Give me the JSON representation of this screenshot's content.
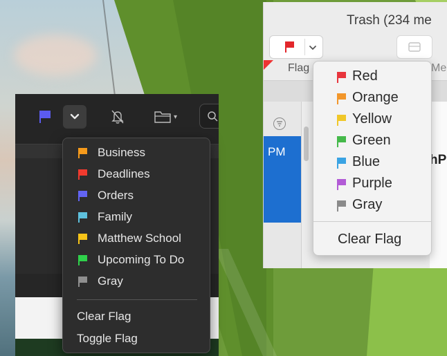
{
  "dark_app": {
    "toolbar": {
      "flag_color": "#5b5bf0",
      "flag_icon": "flag-icon",
      "dropdown_icon": "chevron-down-icon",
      "bell_icon": "bell-slash-icon",
      "folder_icon": "folder-icon",
      "search_icon": "search-icon"
    },
    "menu": {
      "items": [
        {
          "label": "Business",
          "color": "#f59a1b"
        },
        {
          "label": "Deadlines",
          "color": "#f03a2e"
        },
        {
          "label": "Orders",
          "color": "#6264f3"
        },
        {
          "label": "Family",
          "color": "#5ec1dd"
        },
        {
          "label": "Matthew School",
          "color": "#f7c418"
        },
        {
          "label": "Upcoming To Do",
          "color": "#2fd14b"
        },
        {
          "label": "Gray",
          "color": "#8f8f8f"
        }
      ],
      "clear_flag": "Clear Flag",
      "toggle_flag": "Toggle Flag"
    }
  },
  "light_app": {
    "window_title": "Trash (234 me",
    "flag_button_color": "#e2262b",
    "toolbar_flag_label": "Flag",
    "toolbar_me_label": "Me",
    "list_time": "PM",
    "preview_partial": "hP",
    "menu": {
      "items": [
        {
          "label": "Red",
          "color": "#e8353d"
        },
        {
          "label": "Orange",
          "color": "#f2962a"
        },
        {
          "label": "Yellow",
          "color": "#f0c729"
        },
        {
          "label": "Green",
          "color": "#45b94a"
        },
        {
          "label": "Blue",
          "color": "#3aa3e3"
        },
        {
          "label": "Purple",
          "color": "#b25bd6"
        },
        {
          "label": "Gray",
          "color": "#8a8a8a"
        }
      ],
      "clear_flag": "Clear Flag"
    }
  }
}
